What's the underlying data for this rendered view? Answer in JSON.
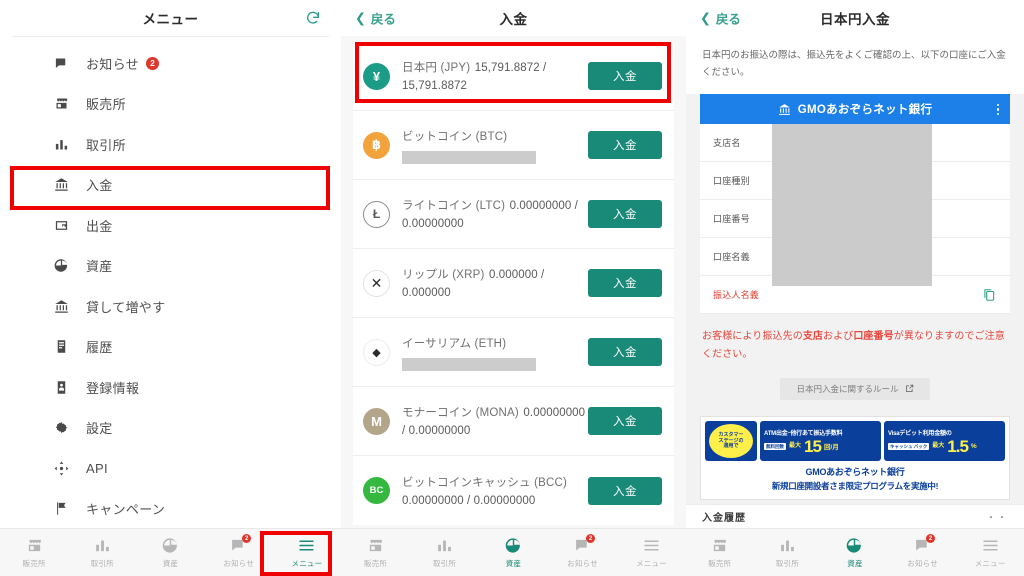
{
  "panel_menu": {
    "header": {
      "title": "メニュー",
      "refresh_icon": "refresh-icon"
    },
    "items": [
      {
        "label": "お知らせ",
        "icon": "notification-flag-icon",
        "badge": "2"
      },
      {
        "label": "販売所",
        "icon": "storefront-icon",
        "badge": ""
      },
      {
        "label": "取引所",
        "icon": "bar-chart-icon",
        "badge": ""
      },
      {
        "label": "入金",
        "icon": "bank-icon",
        "badge": ""
      },
      {
        "label": "出金",
        "icon": "wallet-icon",
        "badge": ""
      },
      {
        "label": "資産",
        "icon": "pie-chart-icon",
        "badge": ""
      },
      {
        "label": "貸して増やす",
        "icon": "bank-icon",
        "badge": ""
      },
      {
        "label": "履歴",
        "icon": "clipboard-icon",
        "badge": ""
      },
      {
        "label": "登録情報",
        "icon": "id-card-icon",
        "badge": ""
      },
      {
        "label": "設定",
        "icon": "gear-icon",
        "badge": ""
      },
      {
        "label": "API",
        "icon": "api-node-icon",
        "badge": ""
      },
      {
        "label": "キャンペーン",
        "icon": "flag-icon",
        "badge": ""
      }
    ]
  },
  "panel_deposit_list": {
    "header": {
      "back": "戻る",
      "title": "入金"
    },
    "coins": [
      {
        "name": "日本円 (JPY)",
        "balance": "15,791.8872 / 15,791.8872",
        "redacted": false,
        "button": "入金",
        "symbol": "¥",
        "color": "#1a9c86"
      },
      {
        "name": "ビットコイン (BTC)",
        "balance": "",
        "redacted": true,
        "button": "入金",
        "symbol": "฿",
        "color": "#f2a33c"
      },
      {
        "name": "ライトコイン (LTC)",
        "balance": "0.00000000 / 0.00000000",
        "redacted": false,
        "button": "入金",
        "symbol": "Ł",
        "color": "#ffffff"
      },
      {
        "name": "リップル (XRP)",
        "balance": "0.000000 / 0.000000",
        "redacted": false,
        "button": "入金",
        "symbol": "✕",
        "color": "#ffffff"
      },
      {
        "name": "イーサリアム (ETH)",
        "balance": "",
        "redacted": true,
        "button": "入金",
        "symbol": "◆",
        "color": "#ffffff"
      },
      {
        "name": "モナーコイン (MONA)",
        "balance": "0.00000000 / 0.00000000",
        "redacted": false,
        "button": "入金",
        "symbol": "M",
        "color": "#b3a58a"
      },
      {
        "name": "ビットコインキャッシュ (BCC)",
        "balance": "0.00000000 / 0.00000000",
        "redacted": false,
        "button": "入金",
        "symbol": "BC",
        "color": "#35b83f"
      }
    ]
  },
  "panel_jpy_deposit": {
    "header": {
      "back": "戻る",
      "title": "日本円入金"
    },
    "description": "日本円のお振込の際は、振込先をよくご確認の上、以下の口座にご入金ください。",
    "bank_bar": {
      "name": "GMOあおぞらネット銀行",
      "icon": "bank-icon",
      "menu_icon": "kebab-menu-icon"
    },
    "account_rows": [
      {
        "label": "支店名",
        "alert": false
      },
      {
        "label": "口座種別",
        "alert": false
      },
      {
        "label": "口座番号",
        "alert": false
      },
      {
        "label": "口座名義",
        "alert": false
      },
      {
        "label": "振込人名義",
        "alert": true
      }
    ],
    "copy_icon": "copy-icon",
    "notice_parts": [
      {
        "text": "お客様により振込先の",
        "bold": false
      },
      {
        "text": "支店",
        "bold": true
      },
      {
        "text": "および",
        "bold": false
      },
      {
        "text": "口座番号",
        "bold": true
      },
      {
        "text": "が異なりますのでご注意ください。",
        "bold": false
      }
    ],
    "rule_button": {
      "label": "日本円入金に関するルール",
      "icon": "external-link-icon"
    },
    "promo": {
      "circle_lines": [
        "カスタマー",
        "ステージの",
        "適用で"
      ],
      "box1_title": "ATM出金･他行あて振込手数料",
      "box1_tag": "無料回数",
      "box1_pre": "最大",
      "box1_value": "15",
      "box1_unit": "回/月",
      "box2_title": "Visaデビット利用金額の",
      "box2_tag": "キャッシュ バック",
      "box2_pre": "最大",
      "box2_value": "1.5",
      "box2_unit": "%",
      "bottom_brand": "GMOあおぞらネット銀行",
      "bottom_line": "新規口座開設者さま限定プログラムを実施中!"
    },
    "history": {
      "title": "入金履歴",
      "more": "・・"
    }
  },
  "tabbar": {
    "tabs": [
      {
        "label": "販売所",
        "icon": "storefront-icon",
        "active": false,
        "badge": ""
      },
      {
        "label": "取引所",
        "icon": "bar-chart-icon",
        "active": false,
        "badge": ""
      },
      {
        "label": "資産",
        "icon": "pie-chart-icon",
        "active": false,
        "badge": ""
      },
      {
        "label": "お知らせ",
        "icon": "notification-flag-icon",
        "active": false,
        "badge": "2"
      },
      {
        "label": "メニュー",
        "icon": "hamburger-icon",
        "active": false,
        "badge": ""
      }
    ],
    "tabs_p2": [
      {
        "label": "販売所",
        "icon": "storefront-icon",
        "active": false,
        "badge": ""
      },
      {
        "label": "取引所",
        "icon": "bar-chart-icon",
        "active": false,
        "badge": ""
      },
      {
        "label": "資産",
        "icon": "pie-chart-icon",
        "active": true,
        "badge": ""
      },
      {
        "label": "お知らせ",
        "icon": "notification-flag-icon",
        "active": false,
        "badge": "2"
      },
      {
        "label": "メニュー",
        "icon": "hamburger-icon",
        "active": false,
        "badge": ""
      }
    ]
  },
  "colors": {
    "teal": "#1a8a78",
    "highlight_red": "#f00000",
    "bank_blue": "#1d7fe8",
    "alert_red": "#e8453c",
    "badge_red": "#e0352b"
  }
}
